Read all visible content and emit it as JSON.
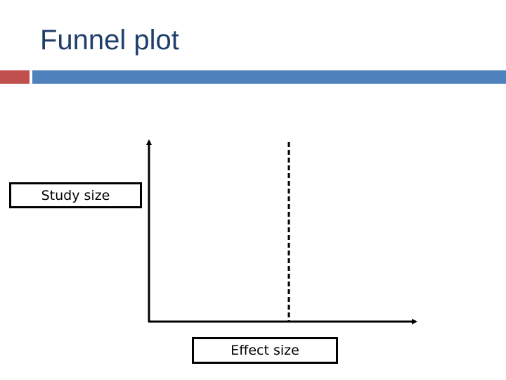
{
  "slide": {
    "title": "Funnel plot",
    "accent_colors": {
      "red_bar": "#c0504d",
      "blue_bar": "#4f81bd",
      "title_text": "#1f3f6b"
    }
  },
  "diagram": {
    "type": "funnel-plot-axes",
    "y_axis_label": "Study size",
    "x_axis_label": "Effect size",
    "reference_line": "dashed vertical line at mean effect",
    "line_color": "#000000"
  }
}
